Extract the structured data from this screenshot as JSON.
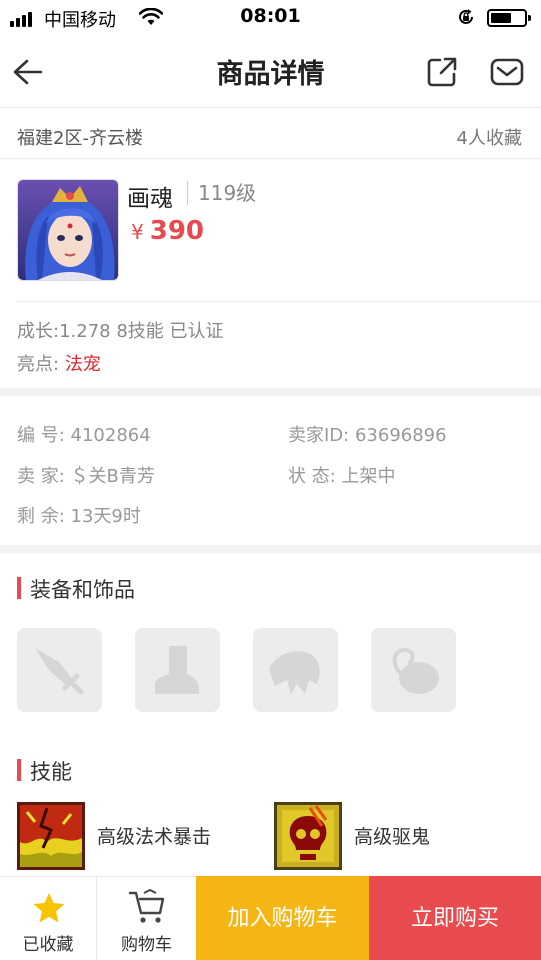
{
  "status_bar": {
    "carrier": "中国移动",
    "time": "08:01"
  },
  "nav": {
    "title": "商品详情",
    "icons": [
      "back-arrow-icon",
      "share-icon",
      "mail-icon"
    ]
  },
  "server": {
    "name": "福建2区-齐云楼",
    "favorites": "4人收藏"
  },
  "item": {
    "name": "画魂",
    "level": "119级",
    "currency": "¥",
    "price": "390",
    "growth": "成长:1.278 8技能 已认证",
    "highlight_label": "亮点:",
    "highlight_value": "法宠"
  },
  "info": {
    "serial_label": "编 号:",
    "serial_value": "4102864",
    "seller_id_label": "卖家ID:",
    "seller_id_value": "63696896",
    "seller_label": "卖 家:",
    "seller_value": "＄关B青芳",
    "status_label": "状 态:",
    "status_value": "上架中",
    "remaining_label": "剩 余:",
    "remaining_value": "13天9时"
  },
  "equipment": {
    "title": "装备和饰品",
    "slots": [
      "weapon-icon",
      "boot-icon",
      "hat-icon",
      "accessory-icon"
    ]
  },
  "skills": {
    "title": "技能",
    "items": [
      {
        "name": "高级法术暴击",
        "icon": "magic-crit-icon"
      },
      {
        "name": "高级驱鬼",
        "icon": "ghost-skull-icon"
      }
    ]
  },
  "bottom_bar": {
    "favorite_label": "已收藏",
    "cart_label": "购物车",
    "add_to_cart": "加入购物车",
    "buy_now": "立即购买"
  },
  "colors": {
    "accent_red": "#e84a4f",
    "highlight_red": "#e8232a",
    "cart_yellow": "#f5b514",
    "star_yellow": "#f7c400"
  }
}
